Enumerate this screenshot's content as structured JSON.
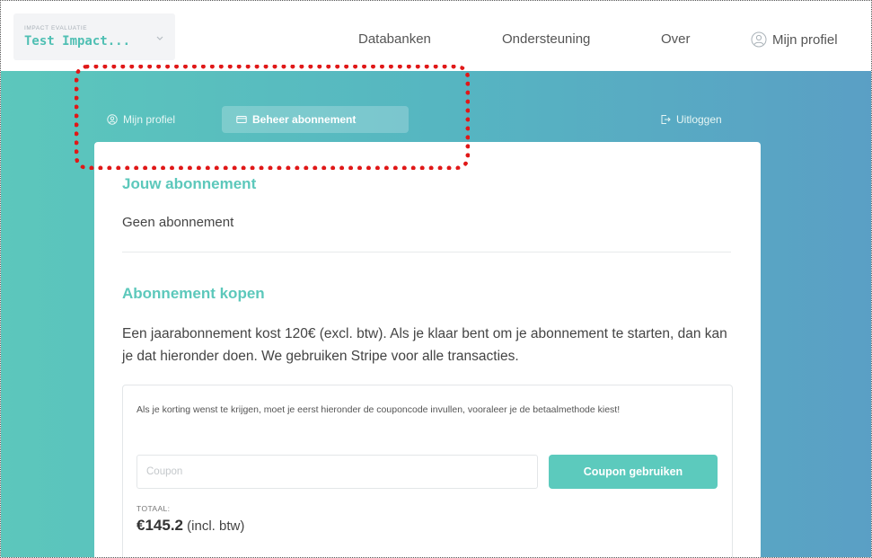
{
  "header": {
    "project_sublabel": "IMPACT EVALUATIE",
    "project_name": "Test Impact...",
    "nav": {
      "databanken": "Databanken",
      "ondersteuning": "Ondersteuning",
      "over": "Over",
      "profile": "Mijn profiel"
    }
  },
  "subnav": {
    "profile": "Mijn profiel",
    "subscription": "Beheer abonnement",
    "logout": "Uitloggen",
    "active": "subscription"
  },
  "subscription": {
    "title": "Jouw abonnement",
    "status": "Geen abonnement"
  },
  "purchase": {
    "title": "Abonnement kopen",
    "description": "Een jaarabonnement kost 120€ (excl. btw). Als je klaar bent om je abonnement te starten, dan kan je dat hieronder doen. We gebruiken Stripe voor alle transacties.",
    "coupon_note": "Als je korting wenst te krijgen, moet je eerst hieronder de couponcode invullen, vooraleer je de betaalmethode kiest!",
    "coupon_placeholder": "Coupon",
    "coupon_button": "Coupon gebruiken",
    "total_label": "TOTAAL:",
    "total_amount": "€145.2",
    "total_suffix": "(incl. btw)"
  },
  "colors": {
    "accent": "#5cc8bb",
    "gradient_start": "#5cc7bc",
    "gradient_end": "#5a9fc5",
    "annotation": "#e01818"
  },
  "icons": {
    "profile": "user-circle-icon",
    "subscription": "credit-card-icon",
    "logout": "logout-icon",
    "project_dropdown": "chevron-down-icon"
  }
}
